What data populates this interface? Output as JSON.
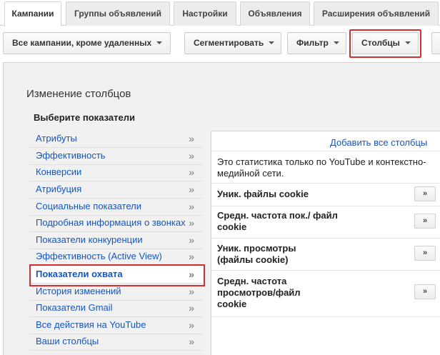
{
  "tabs": [
    {
      "label": "Кампании",
      "active": true
    },
    {
      "label": "Группы объявлений"
    },
    {
      "label": "Настройки"
    },
    {
      "label": "Объявления"
    },
    {
      "label": "Расширения объявлений"
    }
  ],
  "toolbar": {
    "campaign_filter": "Все кампании, кроме удаленных",
    "segment": "Сегментировать",
    "filter": "Фильтр",
    "columns": "Столбцы"
  },
  "panel": {
    "title": "Изменение столбцов",
    "subtitle": "Выберите показатели"
  },
  "categories": [
    {
      "label": "Атрибуты"
    },
    {
      "label": "Эффективность"
    },
    {
      "label": "Конверсии"
    },
    {
      "label": "Атрибуция"
    },
    {
      "label": "Социальные показатели"
    },
    {
      "label": "Подробная информация о звонках"
    },
    {
      "label": "Показатели конкуренции"
    },
    {
      "label": "Эффективность (Active View)"
    },
    {
      "label": "Показатели охвата",
      "selected": true
    },
    {
      "label": "История изменений"
    },
    {
      "label": "Показатели Gmail"
    },
    {
      "label": "Все действия на YouTube"
    },
    {
      "label": "Ваши столбцы"
    }
  ],
  "chevron_glyph": "»",
  "metrics_panel": {
    "add_all": "Добавить все столбцы",
    "note": "Это статистика только по YouTube и контекстно-медийной сети.",
    "add_glyph": "»",
    "items": [
      {
        "name": "Уник. файлы cookie"
      },
      {
        "name": "Средн. частота пок./ файл cookie"
      },
      {
        "name": "Уник. просмотры (файлы cookie)"
      },
      {
        "name": "Средн. частота просмотров/файл cookie"
      }
    ]
  },
  "colors": {
    "link": "#1155cc",
    "highlight": "#d32f2f",
    "panel_bg": "#f1f1f1"
  }
}
